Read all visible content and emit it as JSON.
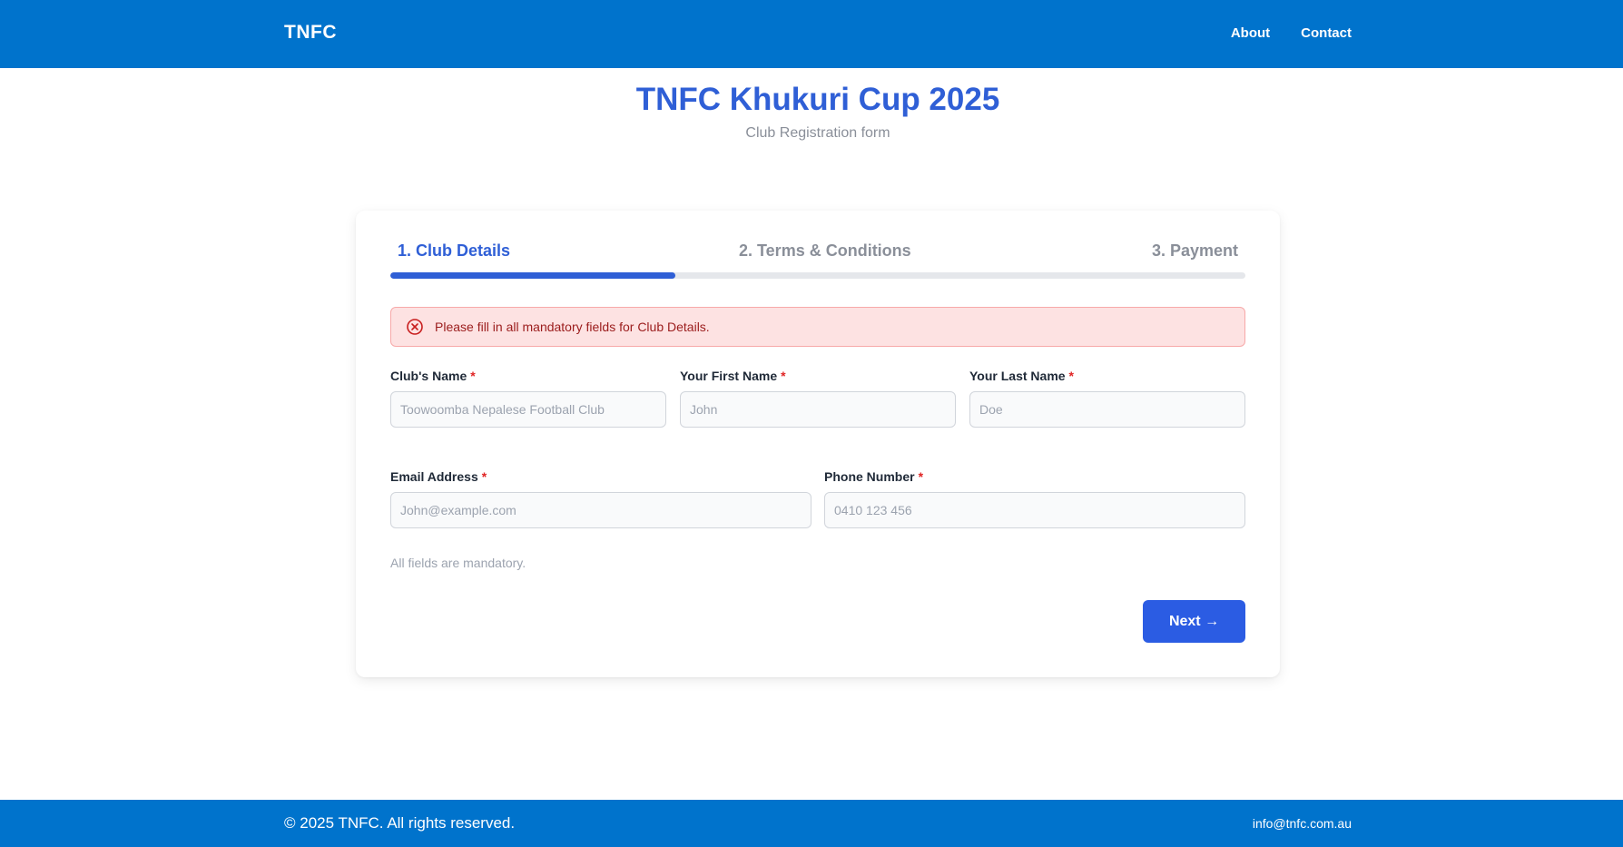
{
  "header": {
    "brand": "TNFC",
    "nav": [
      {
        "label": "About"
      },
      {
        "label": "Contact"
      }
    ]
  },
  "page": {
    "title": "TNFC Khukuri Cup 2025",
    "subtitle": "Club Registration form"
  },
  "wizard": {
    "steps": [
      {
        "label": "1. Club Details",
        "active": true
      },
      {
        "label": "2. Terms & Conditions",
        "active": false
      },
      {
        "label": "3. Payment",
        "active": false
      }
    ],
    "progress_percent": 33.3
  },
  "alert": {
    "message": "Please fill in all mandatory fields for Club Details.",
    "icon": "error-circle-icon"
  },
  "form": {
    "required_mark": "*",
    "club_name": {
      "label": "Club's Name",
      "placeholder": "Toowoomba Nepalese Football Club",
      "value": ""
    },
    "first_name": {
      "label": "Your First Name",
      "placeholder": "John",
      "value": ""
    },
    "last_name": {
      "label": "Your Last Name",
      "placeholder": "Doe",
      "value": ""
    },
    "email": {
      "label": "Email Address",
      "placeholder": "John@example.com",
      "value": ""
    },
    "phone": {
      "label": "Phone Number",
      "placeholder": "0410 123 456",
      "value": ""
    },
    "hint": "All fields are mandatory.",
    "next_label": "Next →"
  },
  "footer": {
    "copyright": "© 2025 TNFC. All rights reserved.",
    "email": "info@tnfc.com.au"
  },
  "colors": {
    "header_bg": "#0073cc",
    "accent": "#2f5fd6",
    "button": "#2b5ce3",
    "alert_bg": "#fde2e2",
    "alert_text": "#9b1c1c"
  }
}
